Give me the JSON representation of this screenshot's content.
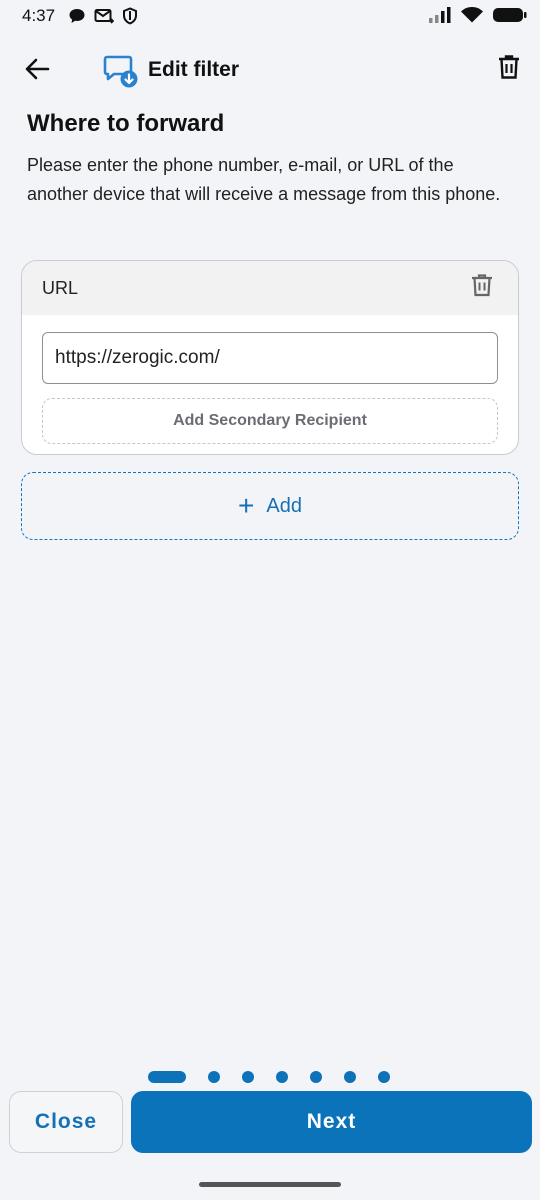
{
  "status_bar": {
    "time": "4:37",
    "left_icons": [
      "chat-bubble-icon",
      "mail-forward-icon",
      "shield-icon"
    ],
    "right_icons": [
      "signal-icon",
      "wifi-icon",
      "battery-icon"
    ]
  },
  "app_bar": {
    "title": "Edit filter",
    "back_icon": "arrow-left-icon",
    "app_icon": "message-forward-icon",
    "delete_icon": "trash-icon"
  },
  "section": {
    "heading": "Where to forward",
    "description": "Please enter the phone number, e-mail, or URL of the another device that will receive a message from this phone."
  },
  "recipient_card": {
    "type_label": "URL",
    "url_value": "https://zerogic.com/",
    "secondary_button_label": "Add Secondary Recipient"
  },
  "add_button": {
    "icon": "+",
    "label": "Add"
  },
  "pager": {
    "total_steps": 7,
    "current_step": 1
  },
  "footer": {
    "close_label": "Close",
    "next_label": "Next"
  },
  "colors": {
    "accent": "#0b73ba",
    "background": "#f2f4f7"
  }
}
